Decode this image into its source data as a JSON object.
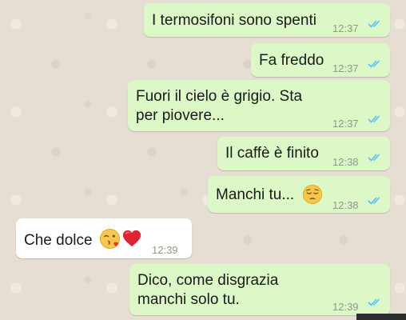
{
  "chat": {
    "messages": [
      {
        "direction": "sent",
        "text": "I termosifoni sono spenti",
        "time": "12:37",
        "status": "read"
      },
      {
        "direction": "sent",
        "text": "Fa freddo",
        "time": "12:37",
        "status": "read"
      },
      {
        "direction": "sent",
        "text": "Fuori il cielo è grigio. Sta\nper piovere...",
        "time": "12:37",
        "status": "read"
      },
      {
        "direction": "sent",
        "text": "Il caffè è finito",
        "time": "12:38",
        "status": "read"
      },
      {
        "direction": "sent",
        "text": "Manchi tu...",
        "time": "12:38",
        "status": "read",
        "emoji": "pensive-face"
      },
      {
        "direction": "received",
        "text": "Che dolce",
        "time": "12:39",
        "emojis": [
          "face-blowing-kiss",
          "red-heart"
        ]
      },
      {
        "direction": "sent",
        "text": "Dico, come disgrazia\nmanchi solo tu.",
        "time": "12:39",
        "status": "read"
      }
    ]
  },
  "colors": {
    "sent_bubble": "#dcf8c6",
    "received_bubble": "#ffffff",
    "read_ticks": "#4fc3f7",
    "timestamp": "#8e9a8a",
    "wallpaper": "#e6ded3"
  }
}
